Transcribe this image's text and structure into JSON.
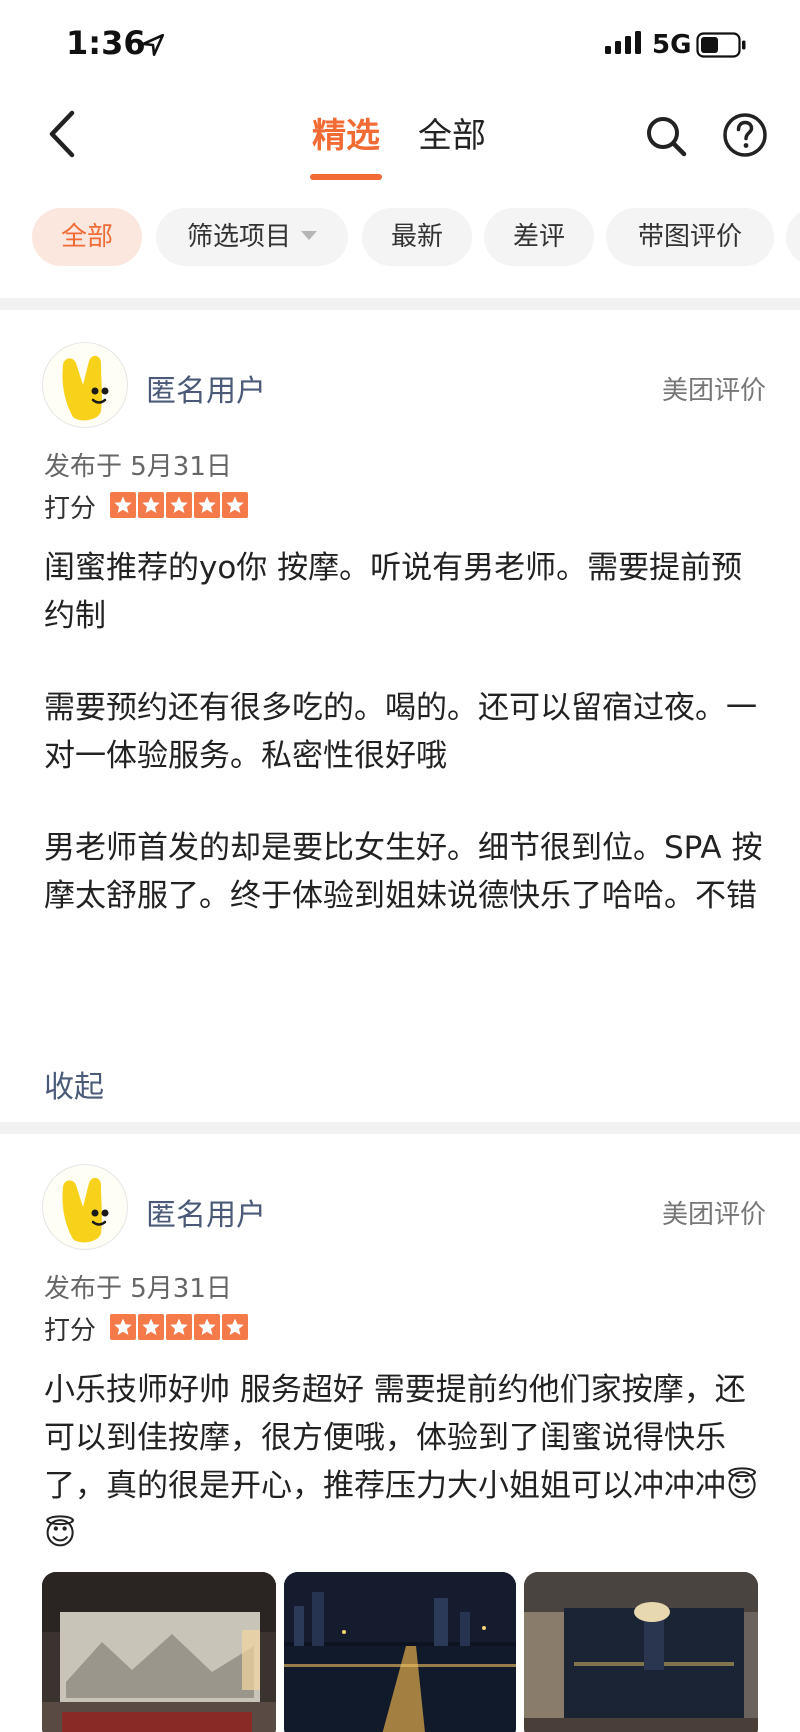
{
  "status_bar": {
    "time": "1:36",
    "network": "5G"
  },
  "header": {
    "tabs": [
      {
        "label": "精选",
        "active": true
      },
      {
        "label": "全部",
        "active": false
      }
    ]
  },
  "filters": [
    {
      "label": "全部",
      "active": true
    },
    {
      "label": "筛选项目",
      "dropdown": true
    },
    {
      "label": "最新"
    },
    {
      "label": "差评"
    },
    {
      "label": "带图评价"
    }
  ],
  "reviews": [
    {
      "user": "匿名用户",
      "source": "美团评价",
      "date": "发布于 5月31日",
      "rating_label": "打分",
      "rating": 5,
      "paragraphs": [
        "闺蜜推荐的yo你 按摩。听说有男老师。需要提前预约制",
        "需要预约还有很多吃的。喝的。还可以留宿过夜。一对一体验服务。私密性很好哦",
        "男老师首发的却是要比女生好。细节很到位。SPA 按摩太舒服了。终于体验到姐妹说德快乐了哈哈。不错"
      ],
      "collapse_label": "收起"
    },
    {
      "user": "匿名用户",
      "source": "美团评价",
      "date": "发布于 5月31日",
      "rating_label": "打分",
      "rating": 5,
      "paragraphs": [
        "小乐技师好帅 服务超好 需要提前约他们家按摩，还可以到佳按摩，很方便哦，体验到了闺蜜说得快乐了，真的很是开心，推荐压力大小姐姐可以冲冲冲😇😇"
      ],
      "photo_count": 3
    }
  ],
  "colors": {
    "accent": "#f26b35",
    "link": "#4a5a78",
    "star": "#f47a4a"
  }
}
